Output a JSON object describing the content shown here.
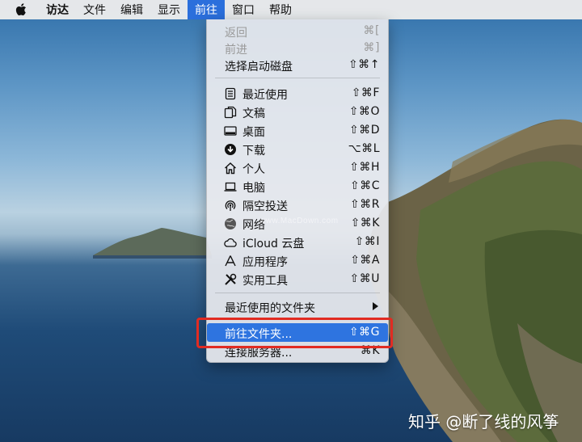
{
  "menubar": {
    "app": "访达",
    "items": [
      "文件",
      "编辑",
      "显示",
      "前往",
      "窗口",
      "帮助"
    ],
    "active": "前往"
  },
  "menu": {
    "back": {
      "label": "返回",
      "shortcut": "⌘["
    },
    "forward": {
      "label": "前进",
      "shortcut": "⌘]"
    },
    "startup_disk": {
      "label": "选择启动磁盘",
      "shortcut": "⇧⌘↑"
    },
    "recents": {
      "label": "最近使用",
      "shortcut": "⇧⌘F",
      "icon": "recents-icon"
    },
    "documents": {
      "label": "文稿",
      "shortcut": "⇧⌘O",
      "icon": "documents-icon"
    },
    "desktop": {
      "label": "桌面",
      "shortcut": "⇧⌘D",
      "icon": "desktop-icon"
    },
    "downloads": {
      "label": "下载",
      "shortcut": "⌥⌘L",
      "icon": "downloads-icon"
    },
    "home": {
      "label": "个人",
      "shortcut": "⇧⌘H",
      "icon": "home-icon"
    },
    "computer": {
      "label": "电脑",
      "shortcut": "⇧⌘C",
      "icon": "computer-icon"
    },
    "airdrop": {
      "label": "隔空投送",
      "shortcut": "⇧⌘R",
      "icon": "airdrop-icon"
    },
    "network": {
      "label": "网络",
      "shortcut": "⇧⌘K",
      "icon": "network-icon"
    },
    "icloud": {
      "label": "iCloud 云盘",
      "shortcut": "⇧⌘I",
      "icon": "icloud-icon"
    },
    "applications": {
      "label": "应用程序",
      "shortcut": "⇧⌘A",
      "icon": "applications-icon"
    },
    "utilities": {
      "label": "实用工具",
      "shortcut": "⇧⌘U",
      "icon": "utilities-icon"
    },
    "recent_folders": {
      "label": "最近使用的文件夹"
    },
    "go_to_folder": {
      "label": "前往文件夹...",
      "shortcut": "⇧⌘G"
    },
    "connect_server": {
      "label": "连接服务器...",
      "shortcut": "⌘K"
    }
  },
  "watermarks": {
    "menu": "www.MacDown.com",
    "corner": "知乎 @断了线的风筝"
  },
  "colors": {
    "highlight": "#2e74e0",
    "annotation": "#e12b22"
  }
}
